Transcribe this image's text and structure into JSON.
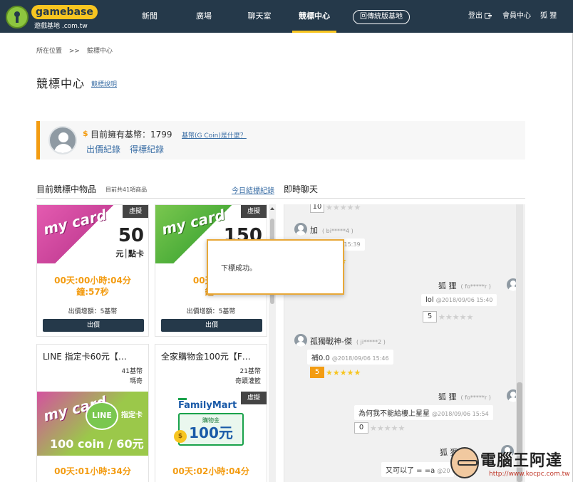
{
  "nav": {
    "logo_name": "gamebase",
    "logo_sub": "遊戲基地 .com.tw",
    "items": [
      "新聞",
      "廣場",
      "聊天室",
      "競標中心"
    ],
    "classic_button": "回傳統版基地",
    "logout": "登出",
    "member_center": "會員中心",
    "username": "狐 狸",
    "colors": {
      "bar": "#25394a",
      "accent": "#f7c520"
    }
  },
  "breadcrumb": {
    "label": "所在位置",
    "sep": ">>",
    "current": "競標中心"
  },
  "page": {
    "title": "競標中心",
    "help_link": "競標說明"
  },
  "wallet": {
    "coin_symbol": "$",
    "balance_label": "目前擁有基幣：1799",
    "coin_help": "基幣(G Coin)是什麼？",
    "bid_history": "出價紀錄",
    "win_history": "得標紀錄"
  },
  "products_section": {
    "title": "目前競標中物品",
    "count": "目前共41項商品",
    "today_link": "今日結標紀錄"
  },
  "chat_section": {
    "title": "即時聊天"
  },
  "products": [
    {
      "brand": "my card",
      "value": "50",
      "unit": "元│點卡",
      "tag": "虛擬",
      "countdown_line1": "00天:00小時:04分",
      "countdown_line2": "鐘:57秒",
      "increment": "出價增額：5基幣",
      "bid_label": "出價"
    },
    {
      "brand": "my card",
      "value": "150",
      "tag": "虛擬",
      "countdown_line1": "00天:01",
      "countdown_line2": "鐘:",
      "increment": "出價增額：5基幣",
      "bid_label": "出價"
    },
    {
      "title": "LINE 指定卡60元【…",
      "price": "41基幣",
      "winner": "瑪奇",
      "brand": "my card",
      "line_badge": "LINE",
      "line_sub": "指定卡",
      "line_value": "100 coin / 60元",
      "countdown_line1": "00天:01小時:34分"
    },
    {
      "title": "全家購物金100元【F…",
      "price": "21基幣",
      "winner": "奇蹟灌籃",
      "tag": "虛擬",
      "fm_logo": "FamilyMart",
      "fm_note_label": "購物金",
      "fm_note_value": "100元",
      "fm_coin": "$",
      "countdown_line1": "00天:02小時:04分"
    }
  ],
  "chat": [
    {
      "type": "rating",
      "num": "10",
      "stars": 0
    },
    {
      "type": "msg",
      "side": "left",
      "name": "加",
      "id": "( bi*****4 )",
      "text": "",
      "time": "18/09/06 15:39"
    },
    {
      "type": "rating",
      "num": "",
      "stars": 5
    },
    {
      "type": "msg",
      "side": "right",
      "name": "狐 狸",
      "id": "( fo*****r )",
      "text": "lol",
      "time": "@2018/09/06 15:40"
    },
    {
      "type": "rating",
      "num": "5",
      "stars": 0
    },
    {
      "type": "msg",
      "side": "left",
      "name": "孤獨戰神-傑",
      "id": "( ji*****2 )",
      "text": "補0.0",
      "time": "@2018/09/06 15:46"
    },
    {
      "type": "rating",
      "num": "5",
      "stars": 5
    },
    {
      "type": "msg",
      "side": "right",
      "name": "狐 狸",
      "id": "( fo*****r )",
      "text": "為何我不能給樓上星星",
      "time": "@2018/09/06 15:54"
    },
    {
      "type": "rating",
      "num": "0",
      "stars": 0
    },
    {
      "type": "msg",
      "side": "right",
      "name": "狐 狸",
      "id": "",
      "text": "又可以了 = =a",
      "time": "@20"
    }
  ],
  "modal": {
    "text": "下標成功。"
  },
  "watermark": {
    "title": "電腦王阿達",
    "url": "http://www.kocpc.com.tw"
  }
}
